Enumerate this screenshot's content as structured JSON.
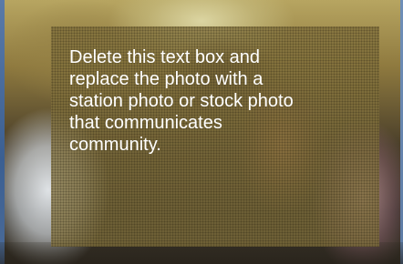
{
  "slide": {
    "placeholder_text": "Delete this text box and replace the photo with a station photo or stock photo that communicates community."
  },
  "colors": {
    "text_box_fill": "#80703C",
    "text_color": "#FFFFFF",
    "frame_blue": "#3B5F92"
  }
}
